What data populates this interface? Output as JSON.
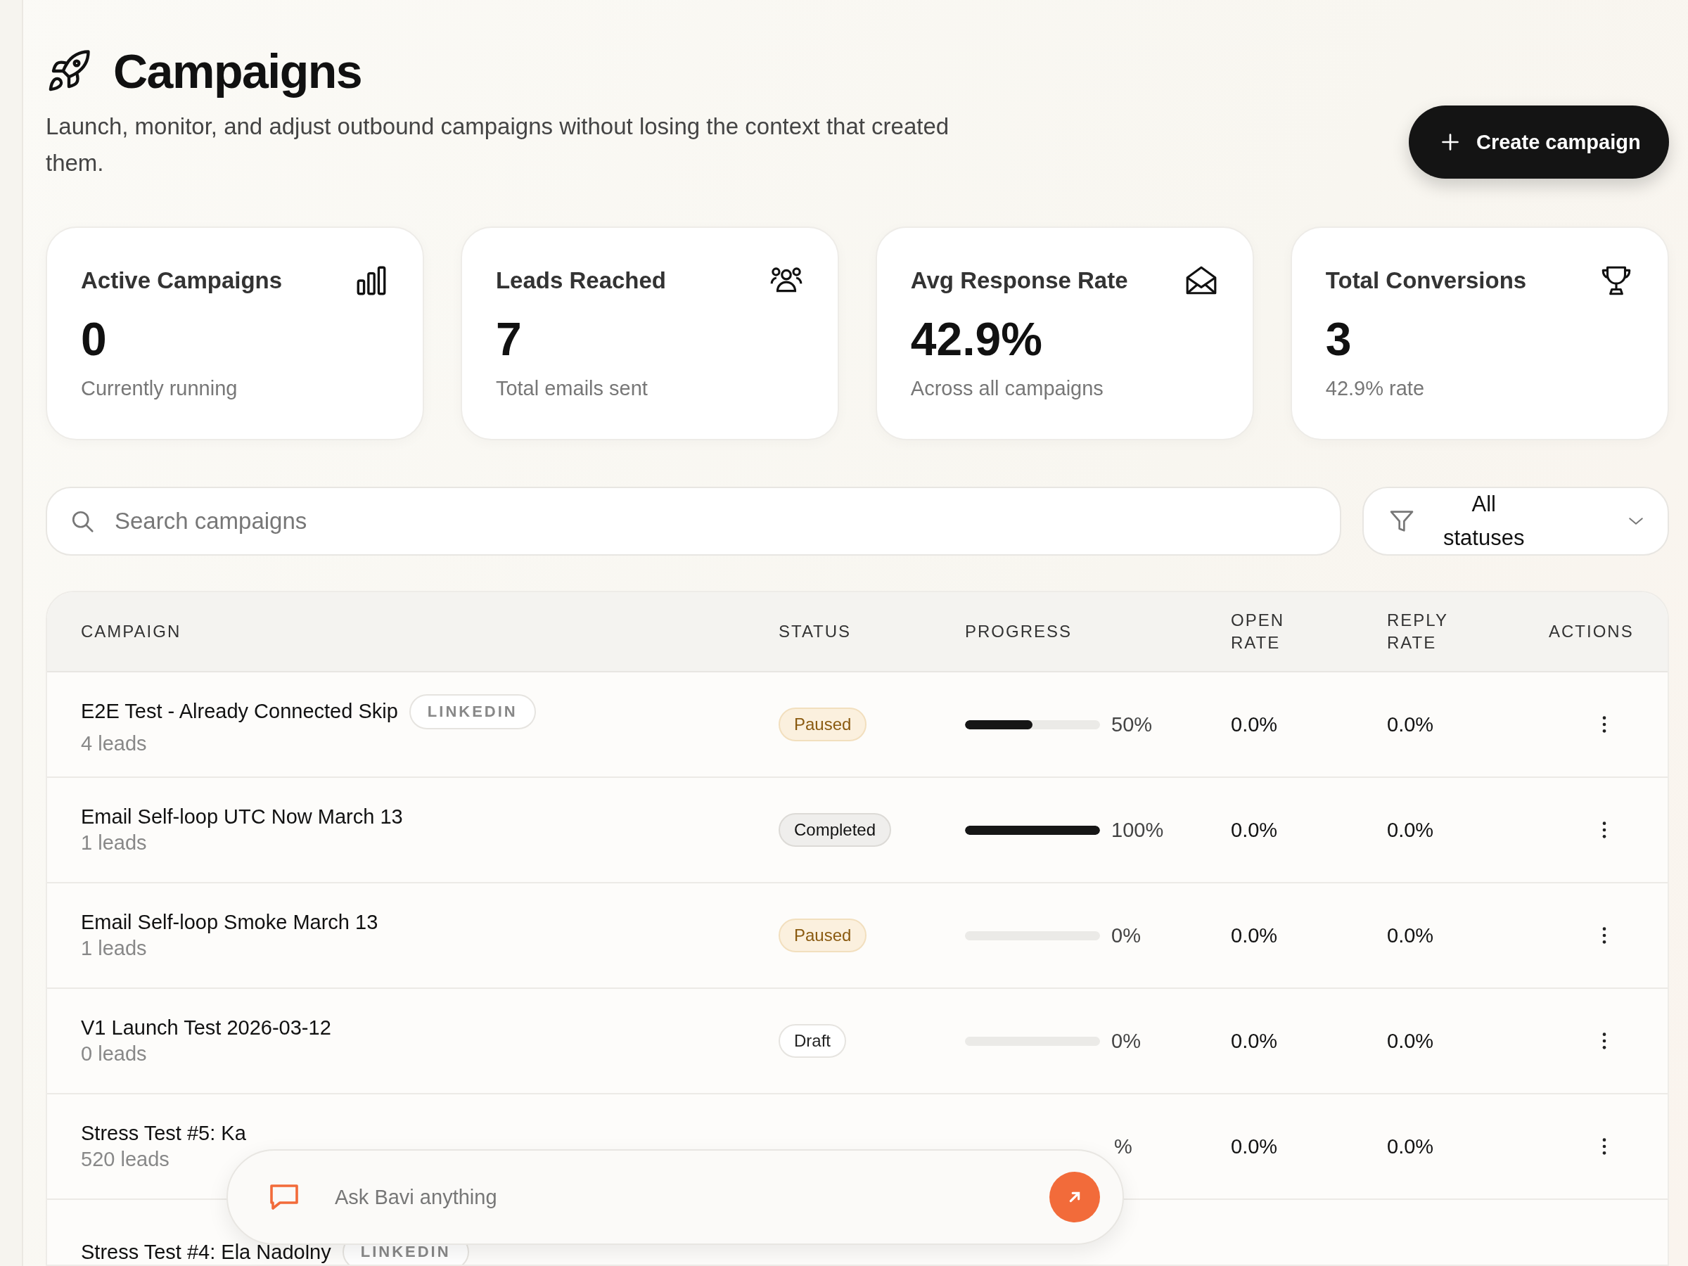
{
  "header": {
    "title": "Campaigns",
    "subtitle": "Launch, monitor, and adjust outbound campaigns without losing the context that created them.",
    "create_button": "Create campaign"
  },
  "stats": [
    {
      "kind": "chart",
      "title": "Active Campaigns",
      "value": "0",
      "caption": "Currently running"
    },
    {
      "kind": "people",
      "title": "Leads Reached",
      "value": "7",
      "caption": "Total emails sent"
    },
    {
      "kind": "mail",
      "title": "Avg Response Rate",
      "value": "42.9%",
      "caption": "Across all campaigns"
    },
    {
      "kind": "trophy",
      "title": "Total Conversions",
      "value": "3",
      "caption": "42.9% rate"
    }
  ],
  "search": {
    "placeholder": "Search campaigns"
  },
  "status_filter": {
    "value": "All statuses"
  },
  "table": {
    "columns": [
      "CAMPAIGN",
      "STATUS",
      "PROGRESS",
      "OPEN RATE",
      "REPLY RATE",
      "ACTIONS"
    ],
    "rows": [
      {
        "name": "E2E Test - Already Connected Skip",
        "channel": "LINKEDIN",
        "leads": "4 leads",
        "status": {
          "label": "Paused",
          "kind": "paused"
        },
        "level": 0.5,
        "progress": "50%",
        "open_rate": "0.0%",
        "reply_rate": "0.0%"
      },
      {
        "name": "Email Self-loop UTC Now March 13",
        "leads": "1 leads",
        "status": {
          "label": "Completed",
          "kind": "completed"
        },
        "level": 1,
        "progress": "100%",
        "open_rate": "0.0%",
        "reply_rate": "0.0%"
      },
      {
        "name": "Email Self-loop Smoke March 13",
        "leads": "1 leads",
        "status": {
          "label": "Paused",
          "kind": "paused"
        },
        "level": 0,
        "progress": "0%",
        "open_rate": "0.0%",
        "reply_rate": "0.0%"
      },
      {
        "name": "V1 Launch Test 2026-03-12",
        "leads": "0 leads",
        "status": {
          "label": "Draft",
          "kind": "draft"
        },
        "level": 0,
        "progress": "0%",
        "open_rate": "0.0%",
        "reply_rate": "0.0%"
      },
      {
        "name": "Stress Test #5: Ka",
        "leads": "520 leads",
        "progress": "%",
        "open_rate": "0.0%",
        "reply_rate": "0.0%"
      },
      {
        "name": "Stress Test #4: Ela Nadolny",
        "channel": "LINKEDIN"
      }
    ]
  },
  "assistant": {
    "placeholder": "Ask Bavi anything"
  }
}
